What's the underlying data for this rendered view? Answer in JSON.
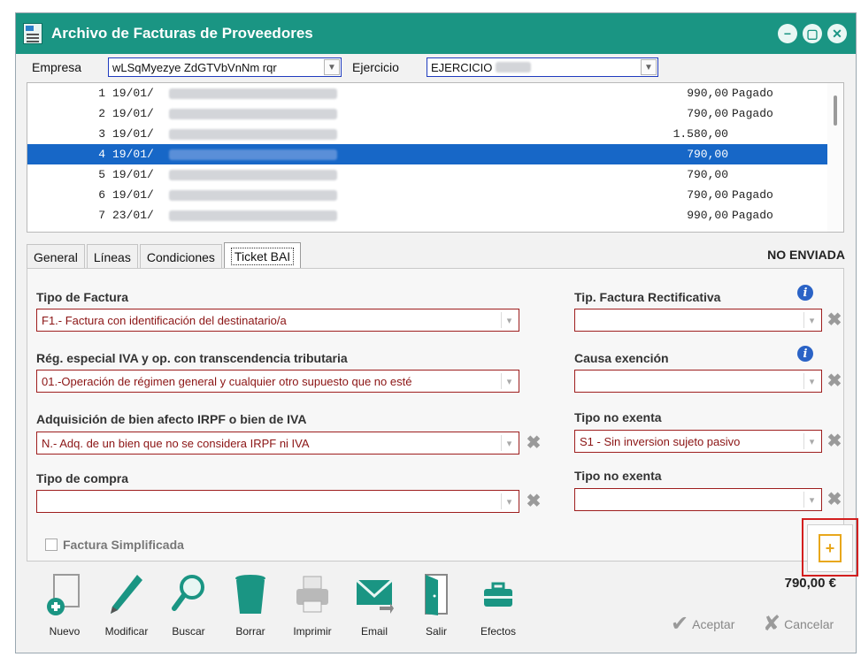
{
  "window": {
    "title": "Archivo de Facturas de Proveedores",
    "controls": [
      "minimize-icon",
      "restore-icon",
      "close-icon"
    ]
  },
  "toprow": {
    "empresa_label": "Empresa",
    "empresa_value": "wLSqMyezye ZdGTVbVnNm rqr",
    "ejercicio_label": "Ejercicio",
    "ejercicio_value": "EJERCICIO"
  },
  "list": {
    "rows": [
      {
        "num": "1",
        "date": "19/01/",
        "amount": "990,00",
        "state": "Pagado"
      },
      {
        "num": "2",
        "date": "19/01/",
        "amount": "790,00",
        "state": "Pagado"
      },
      {
        "num": "3",
        "date": "19/01/",
        "amount": "1.580,00",
        "state": ""
      },
      {
        "num": "4",
        "date": "19/01/",
        "amount": "790,00",
        "state": ""
      },
      {
        "num": "5",
        "date": "19/01/",
        "amount": "790,00",
        "state": ""
      },
      {
        "num": "6",
        "date": "19/01/",
        "amount": "790,00",
        "state": "Pagado"
      },
      {
        "num": "7",
        "date": "23/01/",
        "amount": "990,00",
        "state": "Pagado"
      }
    ],
    "selected_index": 3
  },
  "tabs": [
    "General",
    "Líneas",
    "Condiciones",
    "Ticket BAI"
  ],
  "active_tab": "Ticket BAI",
  "send_status": "NO ENVIADA",
  "form": {
    "tipo_factura_label": "Tipo de Factura",
    "tipo_factura_value": "F1.- Factura con identificación del destinatario/a",
    "reg_especial_label": "Rég. especial IVA y op. con transcendencia tributaria",
    "reg_especial_value": "01.-Operación de régimen general y cualquier otro supuesto que no esté",
    "adquisicion_label": "Adquisición de bien afecto IRPF o bien de IVA",
    "adquisicion_value": "N.- Adq. de un bien que no se considera IRPF ni IVA",
    "tipo_compra_label": "Tipo de compra",
    "tipo_compra_value": "",
    "tip_rectificativa_label": "Tip. Factura Rectificativa",
    "tip_rectificativa_value": "",
    "causa_exencion_label": "Causa exención",
    "causa_exencion_value": "",
    "tipo_no_exenta_label": "Tipo no exenta",
    "tipo_no_exenta_value": "S1 - Sin inversion sujeto pasivo",
    "tipo_no_exenta2_label": "Tipo no exenta",
    "tipo_no_exenta2_value": "",
    "simplificada_label": "Factura Simplificada"
  },
  "toolbar": {
    "buttons": [
      "Nuevo",
      "Modificar",
      "Buscar",
      "Borrar",
      "Imprimir",
      "Email",
      "Salir",
      "Efectos"
    ]
  },
  "total": "790,00 €",
  "actions": {
    "aceptar": "Aceptar",
    "cancelar": "Cancelar"
  },
  "colors": {
    "titlebar": "#1a9583",
    "selection": "#1767c7",
    "field_border": "#9e1e1e",
    "highlight": "#d31f1f"
  }
}
